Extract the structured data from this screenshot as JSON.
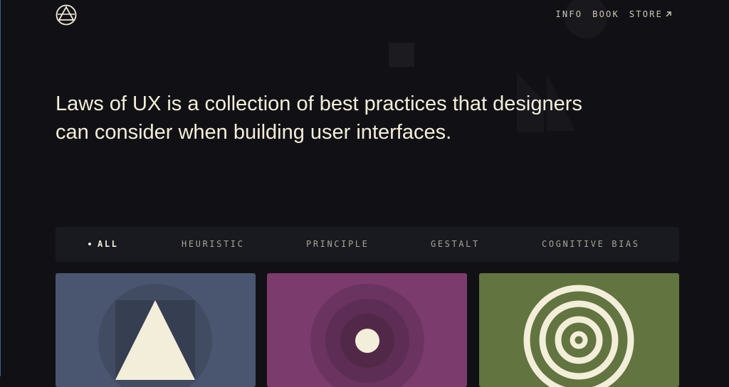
{
  "header": {
    "logo_icon": "triangle-in-circle-logo",
    "nav": [
      {
        "label": "INFO"
      },
      {
        "label": "BOOK"
      },
      {
        "label": "STORE",
        "icon": "external-arrow-icon"
      }
    ]
  },
  "hero": {
    "headline_line1": "Laws of UX is a collection of best practices that designers",
    "headline_line2": "can consider when building user interfaces."
  },
  "filters": {
    "items": [
      {
        "label": "ALL",
        "active": true
      },
      {
        "label": "HEURISTIC"
      },
      {
        "label": "PRINCIPLE"
      },
      {
        "label": "GESTALT"
      },
      {
        "label": "COGNITIVE BIAS"
      }
    ]
  },
  "cards": [
    {
      "illustration": "triangle-in-circle-illustration",
      "color": "#4a5670"
    },
    {
      "illustration": "concentric-circles-illustration",
      "color": "#7b3b6d"
    },
    {
      "illustration": "target-rings-illustration",
      "color": "#627440"
    }
  ],
  "colors": {
    "background": "#111115",
    "text": "#f3eed9",
    "filterbar": "#191920"
  }
}
